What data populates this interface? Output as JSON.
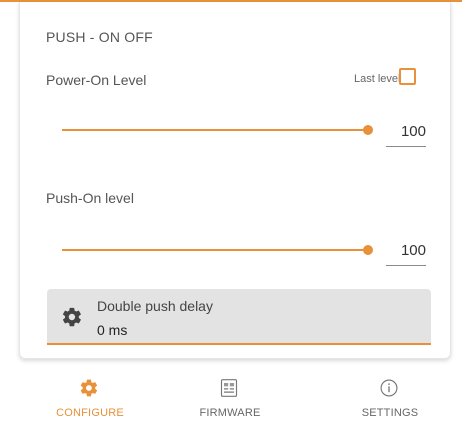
{
  "section": {
    "title": "PUSH - ON OFF"
  },
  "power_on": {
    "label": "Power-On Level",
    "last_level_label": "Last level",
    "last_level_checked": false,
    "slider_fraction": 1.0,
    "value": "100"
  },
  "push_on": {
    "label": "Push-On level",
    "slider_fraction": 1.0,
    "value": "100"
  },
  "double_push": {
    "label": "Double push delay",
    "value": "0 ms",
    "icon": "gear-icon"
  },
  "nav": {
    "items": [
      {
        "label": "CONFIGURE",
        "icon": "gear-icon",
        "active": true
      },
      {
        "label": "FIRMWARE",
        "icon": "firmware-icon",
        "active": false
      },
      {
        "label": "SETTINGS",
        "icon": "info-icon",
        "active": false
      }
    ]
  },
  "colors": {
    "accent": "#e8913a",
    "panel": "#e3e3e3",
    "text": "#555555"
  }
}
